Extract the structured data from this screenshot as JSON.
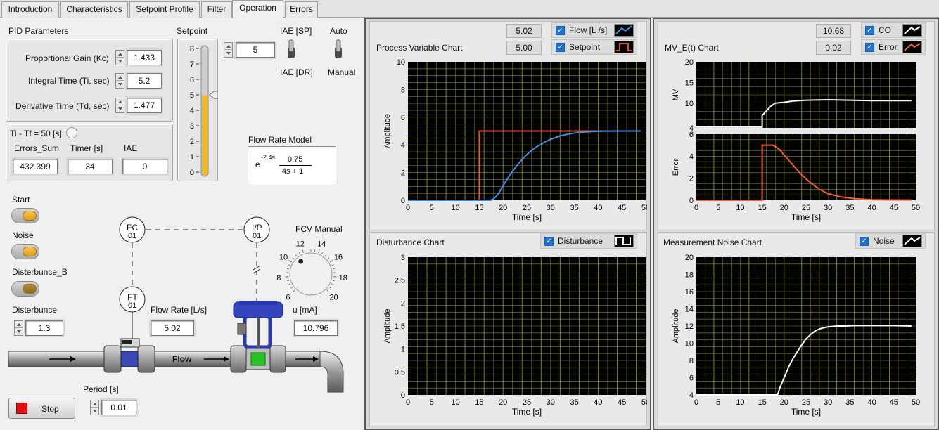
{
  "tabs": [
    "Introduction",
    "Characteristics",
    "Setpoint Profile",
    "Filter",
    "Operation",
    "Errors"
  ],
  "active_tab": "Operation",
  "pid": {
    "title": "PID Parameters",
    "kc_label": "Proportional Gain (Kc)",
    "kc": "1.433",
    "ti_label": "Integral Time (Ti, sec)",
    "ti": "5.2",
    "td_label": "Derivative Time (Td, sec)",
    "td": "1.477"
  },
  "timer": {
    "ti_tf_label": "Ti - Tf = 50 [s]",
    "errors_sum_label": "Errors_Sum",
    "errors_sum": "432.399",
    "timer_label": "Timer [s]",
    "timer": "34",
    "iae_label": "IAE",
    "iae": "0"
  },
  "setpoint": {
    "label": "Setpoint",
    "value": "5",
    "level": 5,
    "scale": [
      "8",
      "7",
      "6",
      "5",
      "4",
      "3",
      "2",
      "1",
      "0"
    ]
  },
  "switches": {
    "iae_sp": "IAE [SP]",
    "iae_dr": "IAE [DR]",
    "auto": "Auto",
    "manual": "Manual"
  },
  "model": {
    "title": "Flow Rate Model",
    "exp": "e",
    "exp_power": "-2.4s",
    "numerator": "0.75",
    "denominator": "4s + 1"
  },
  "buttons": {
    "start": "Start",
    "noise": "Noise",
    "disturbance_b": "Disterbunce_B",
    "stop": "Stop"
  },
  "disturbance": {
    "label": "Disterbunce",
    "value": "1.3"
  },
  "period": {
    "label": "Period [s]",
    "value": "0.01"
  },
  "process": {
    "fc": "FC",
    "fc_n": "01",
    "ip": "I/P",
    "ip_n": "01",
    "ft": "FT",
    "ft_n": "01",
    "flow_rate_label": "Flow Rate [L/s]",
    "flow_rate": "5.02",
    "u_label": "u [mA]",
    "u": "10.796",
    "flow_label": "Flow"
  },
  "fcv": {
    "label": "FCV Manual",
    "ticks": [
      "6",
      "8",
      "10",
      "12",
      "14",
      "16",
      "18",
      "20"
    ],
    "value": 11
  },
  "colors": {
    "flow": "#3d8ee8",
    "setpoint": "#e5512a",
    "grid": "#8c8c2a",
    "bg": "#000000",
    "co": "#ffffff",
    "error": "#f0603a"
  },
  "pv_chart": {
    "title": "Process Variable Chart",
    "readout1": "5.02",
    "readout2": "5.00",
    "legend1": "Flow [L /s]",
    "legend2": "Setpoint",
    "ylabel": "Amplitude",
    "xlabel": "Time [s]",
    "yticks": [
      "10",
      "8",
      "6",
      "4",
      "2",
      "0"
    ],
    "xticks": [
      "0",
      "5",
      "10",
      "15",
      "20",
      "25",
      "30",
      "35",
      "40",
      "45",
      "50"
    ]
  },
  "dist_chart": {
    "title": "Disturbance Chart",
    "legend": "Disturbance",
    "ylabel": "Amplitude",
    "xlabel": "Time [s]",
    "yticks": [
      "3",
      "2.5",
      "2",
      "1.5",
      "1",
      "0.5",
      "0"
    ],
    "xticks": [
      "0",
      "5",
      "10",
      "15",
      "20",
      "25",
      "30",
      "35",
      "40",
      "45",
      "50"
    ]
  },
  "mv_chart": {
    "title": "MV_E(t) Chart",
    "readout1": "10.68",
    "readout2": "0.02",
    "legend1": "CO",
    "legend2": "Error",
    "mv_label": "MV",
    "err_label": "Error",
    "xlabel": "Time [s]",
    "mv_yticks": [
      "20",
      "15",
      "10",
      "4"
    ],
    "err_yticks": [
      "6",
      "4",
      "2",
      "0"
    ],
    "xticks": [
      "0",
      "5",
      "10",
      "15",
      "20",
      "25",
      "30",
      "35",
      "40",
      "45",
      "50"
    ]
  },
  "noise_chart": {
    "title": "Measurement Noise Chart",
    "legend": "Noise",
    "ylabel": "Amplitude",
    "xlabel": "Time [s]",
    "yticks": [
      "20",
      "18",
      "16",
      "14",
      "12",
      "10",
      "8",
      "6",
      "4"
    ],
    "xticks": [
      "0",
      "5",
      "10",
      "15",
      "20",
      "25",
      "30",
      "35",
      "40",
      "45",
      "50"
    ]
  },
  "chart_data": [
    {
      "type": "line",
      "title": "Process Variable Chart",
      "xlabel": "Time [s]",
      "ylabel": "Amplitude",
      "xlim": [
        0,
        50
      ],
      "ylim": [
        0,
        10
      ],
      "series": [
        {
          "name": "Setpoint",
          "x": [
            0,
            15,
            15,
            49
          ],
          "y": [
            0,
            0,
            5,
            5
          ]
        },
        {
          "name": "Flow [L /s]",
          "x": [
            0,
            17.4,
            18,
            19,
            20,
            21,
            22,
            23,
            24,
            25,
            26,
            27,
            28,
            29,
            30,
            32,
            34,
            36,
            38,
            40,
            45,
            49
          ],
          "y": [
            0,
            0,
            0.1,
            0.45,
            1.05,
            1.6,
            2.1,
            2.55,
            2.95,
            3.3,
            3.6,
            3.85,
            4.05,
            4.25,
            4.4,
            4.65,
            4.8,
            4.9,
            4.95,
            4.98,
            5.0,
            5.0
          ]
        }
      ]
    },
    {
      "type": "line",
      "title": "Disturbance Chart",
      "xlabel": "Time [s]",
      "ylabel": "Amplitude",
      "xlim": [
        0,
        50
      ],
      "ylim": [
        0,
        3
      ],
      "series": []
    },
    {
      "type": "line",
      "title": "MV_E(t) Chart",
      "xlabel": "Time [s]",
      "xlim": [
        0,
        50
      ],
      "panels": [
        {
          "ylabel": "MV",
          "ylim": [
            4,
            20
          ],
          "series": [
            {
              "name": "CO",
              "x": [
                0,
                15,
                15,
                17,
                18,
                20,
                22,
                25,
                30,
                35,
                40,
                45,
                49
              ],
              "y": [
                4.2,
                4.2,
                7.0,
                9.3,
                10.0,
                10.2,
                10.5,
                10.7,
                10.8,
                10.7,
                10.6,
                10.6,
                10.6
              ]
            }
          ]
        },
        {
          "ylabel": "Error",
          "ylim": [
            0,
            6
          ],
          "series": [
            {
              "name": "Error",
              "x": [
                0,
                15,
                15,
                17.5,
                19,
                20,
                22,
                24,
                26,
                28,
                30,
                33,
                36,
                40,
                49
              ],
              "y": [
                0,
                0,
                5,
                5,
                4.6,
                4.1,
                3.2,
                2.3,
                1.6,
                1.0,
                0.6,
                0.3,
                0.15,
                0.05,
                0.02
              ]
            }
          ]
        }
      ]
    },
    {
      "type": "line",
      "title": "Measurement Noise Chart",
      "xlabel": "Time [s]",
      "ylabel": "Amplitude",
      "xlim": [
        0,
        50
      ],
      "ylim": [
        4,
        20
      ],
      "series": [
        {
          "name": "Noise",
          "x": [
            0,
            18.5,
            19,
            20,
            21,
            22,
            23,
            24,
            25,
            26,
            27,
            28,
            29,
            30,
            32,
            34,
            36,
            40,
            45,
            49
          ],
          "y": [
            4,
            4,
            4.8,
            6.0,
            7.2,
            8.2,
            9.0,
            9.8,
            10.5,
            11.0,
            11.4,
            11.65,
            11.8,
            11.9,
            12.0,
            12.0,
            12.05,
            12.05,
            12.05,
            12.0
          ]
        }
      ]
    }
  ]
}
